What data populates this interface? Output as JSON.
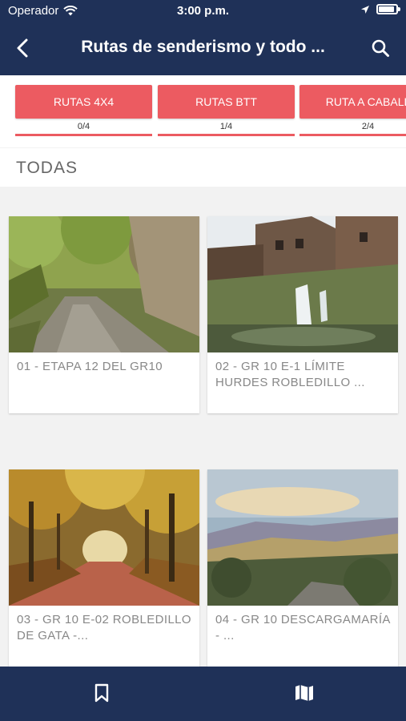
{
  "status_bar": {
    "carrier": "Operador",
    "time": "3:00 p.m.",
    "battery_level": 0.9,
    "icons": [
      "wifi-icon",
      "location-arrow-icon",
      "battery-icon"
    ]
  },
  "nav": {
    "title": "Rutas de senderismo y todo ...",
    "back_icon": "chevron-left-icon",
    "search_icon": "search-icon"
  },
  "categories": [
    {
      "label": "RUTAS 4X4",
      "count": "0/4"
    },
    {
      "label": "RUTAS BTT",
      "count": "1/4"
    },
    {
      "label": "RUTA A CABALL",
      "count": "2/4"
    }
  ],
  "section_title": "TODAS",
  "routes": [
    {
      "title": "01 - ETAPA 12 DEL GR10",
      "image": "forest-stone-path"
    },
    {
      "title": "02 - GR 10 E-1 LÍMITE HURDES ROBLEDILLO ...",
      "image": "stone-village-waterfall"
    },
    {
      "title": "03 - GR 10 E-02 ROBLEDILLO DE GATA -...",
      "image": "autumn-tree-tunnel-road"
    },
    {
      "title": "04 - GR 10 DESCARGAMARÍA - ...",
      "image": "mountain-valley-sunset"
    }
  ],
  "tabbar": {
    "items": [
      "bookmark-icon",
      "map-icon"
    ]
  },
  "colors": {
    "primary": "#1f3158",
    "accent": "#ec5b61",
    "background": "#f2f2f2"
  }
}
